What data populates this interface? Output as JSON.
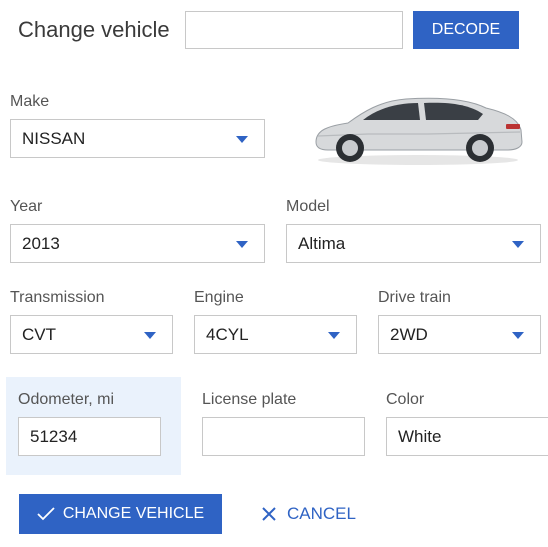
{
  "header": {
    "title": "Change vehicle",
    "vin_value": "",
    "decode_label": "DECODE"
  },
  "make": {
    "label": "Make",
    "value": "NISSAN"
  },
  "year": {
    "label": "Year",
    "value": "2013"
  },
  "model": {
    "label": "Model",
    "value": "Altima"
  },
  "transmission": {
    "label": "Transmission",
    "value": "CVT"
  },
  "engine": {
    "label": "Engine",
    "value": "4CYL"
  },
  "drive_train": {
    "label": "Drive train",
    "value": "2WD"
  },
  "odometer": {
    "label": "Odometer, mi",
    "value": "51234"
  },
  "license_plate": {
    "label": "License plate",
    "value": ""
  },
  "color": {
    "label": "Color",
    "value": "White"
  },
  "actions": {
    "change_label": "CHANGE VEHICLE",
    "cancel_label": "CANCEL"
  },
  "colors": {
    "accent": "#2f63c4",
    "odometer_highlight": "#eaf2fc",
    "border": "#c8c8c8"
  },
  "icons": [
    "chevron-down-icon",
    "check-icon",
    "close-icon",
    "car-image"
  ]
}
